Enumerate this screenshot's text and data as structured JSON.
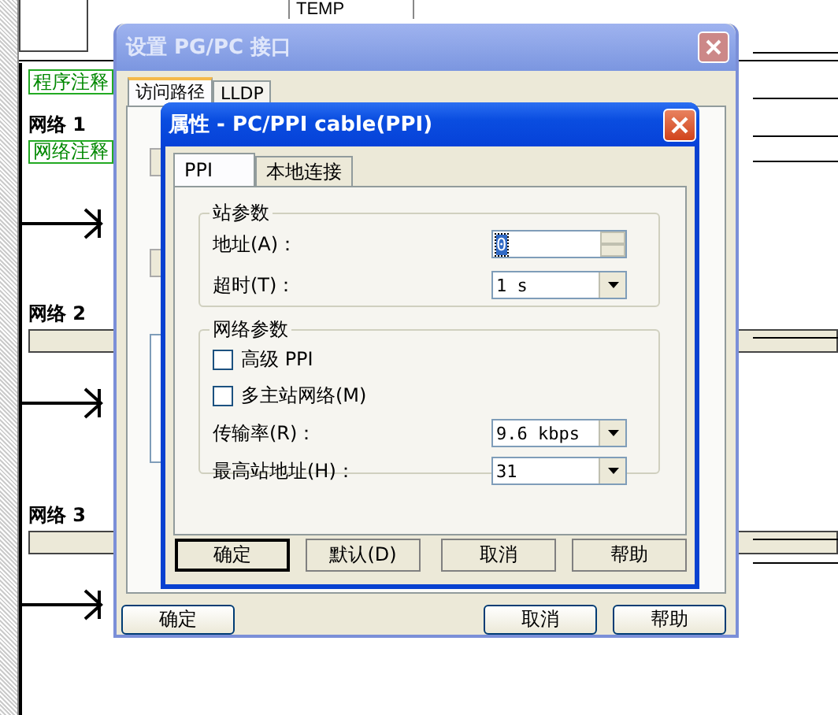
{
  "editor": {
    "header_cell": "TEMP",
    "program_comment": "程序注释",
    "networks": [
      {
        "title": "网络 1",
        "comment": "网络注释"
      },
      {
        "title": "网络 2"
      },
      {
        "title": "网络 3"
      }
    ]
  },
  "setup_dialog": {
    "title": "设置 PG/PC 接口",
    "tabs": [
      {
        "label": "访问路径",
        "selected": true
      },
      {
        "label": "LLDP",
        "selected": false
      }
    ],
    "buttons": [
      "确定",
      "取消",
      "帮助"
    ]
  },
  "properties_dialog": {
    "title": "属性 - PC/PPI cable(PPI)",
    "tabs": [
      {
        "label": "PPI",
        "selected": true
      },
      {
        "label": "本地连接",
        "selected": false
      }
    ],
    "station_group": {
      "title": "站参数",
      "address": {
        "label": "地址(A)：",
        "value": "0"
      },
      "timeout": {
        "label": "超时(T)：",
        "value": "1 s"
      }
    },
    "network_group": {
      "title": "网络参数",
      "options": [
        {
          "label": "高级 PPI",
          "checked": false
        },
        {
          "label": "多主站网络(M)",
          "checked": false
        }
      ],
      "baud_rate": {
        "label": "传输率(R)：",
        "value": "9.6 kbps"
      },
      "highest_address": {
        "label": "最高站地址(H)：",
        "value": "31"
      }
    },
    "buttons": [
      "确定",
      "默认(D)",
      "取消",
      "帮助"
    ]
  }
}
